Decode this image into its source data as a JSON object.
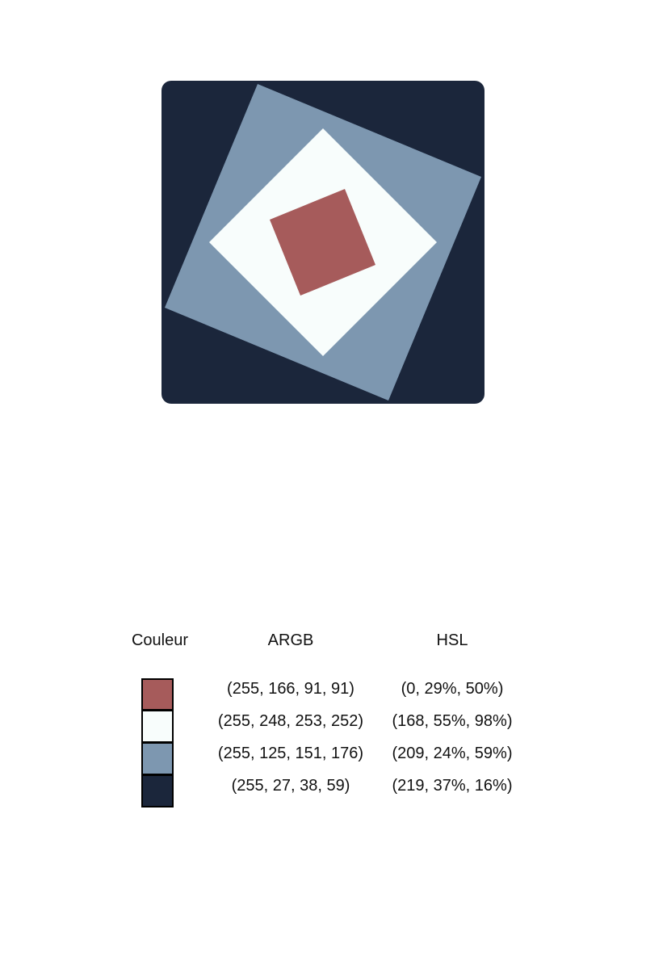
{
  "colors": {
    "dark": "#1b263b",
    "blue": "#7d97b0",
    "white": "#f8fdfc",
    "red": "#a65b5b"
  },
  "table": {
    "headers": {
      "color": "Couleur",
      "argb": "ARGB",
      "hsl": "HSL"
    },
    "rows": [
      {
        "hex": "#a65b5b",
        "argb": "(255, 166, 91, 91)",
        "hsl": "(0, 29%, 50%)"
      },
      {
        "hex": "#f8fdfc",
        "argb": "(255, 248, 253, 252)",
        "hsl": "(168, 55%, 98%)"
      },
      {
        "hex": "#7d97b0",
        "argb": "(255, 125, 151, 176)",
        "hsl": "(209, 24%, 59%)"
      },
      {
        "hex": "#1b263b",
        "argb": "(255, 27, 38, 59)",
        "hsl": "(219, 37%, 16%)"
      }
    ]
  }
}
